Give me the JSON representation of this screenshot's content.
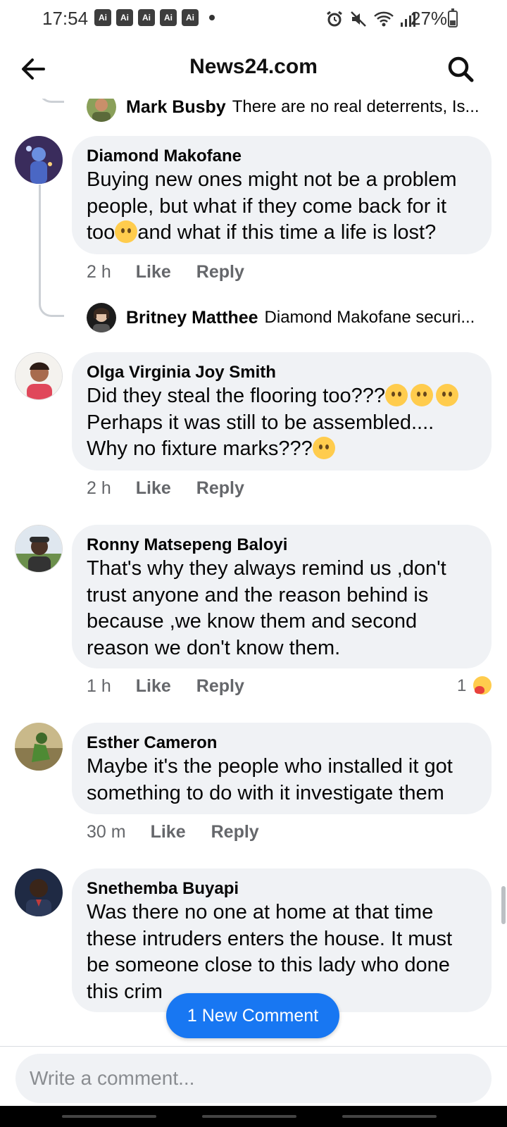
{
  "status_bar": {
    "time": "17:54",
    "ai_badges": [
      "Ai",
      "Ai",
      "Ai",
      "Ai",
      "Ai"
    ],
    "battery": "27%",
    "icons": [
      "alarm-icon",
      "mute-icon",
      "wifi-icon",
      "signal-icon",
      "battery-icon"
    ]
  },
  "header": {
    "title": "News24.com",
    "back_icon": "arrow-left-icon",
    "search_icon": "search-icon"
  },
  "comments": {
    "top_reply": {
      "author": "Mark Busby",
      "text": "There are no real deterrents, Is..."
    },
    "items": [
      {
        "author": "Diamond Makofane",
        "text_before_emoji": "Buying new ones might not be a problem people, but what if they come back for it too",
        "text_after_emoji": "and what if this time a life is lost?",
        "time": "2 h",
        "like": "Like",
        "reply": "Reply",
        "reply_preview": {
          "author": "Britney Matthee",
          "text": "Diamond Makofane securi..."
        }
      },
      {
        "author": "Olga Virginia Joy Smith",
        "line1": "Did they steal the flooring too???",
        "line2": "Perhaps it was still to be assembled....",
        "line3": "Why no fixture marks???",
        "time": "2 h",
        "like": "Like",
        "reply": "Reply"
      },
      {
        "author": "Ronny Matsepeng Baloyi",
        "text": "That's why they always remind us ,don't trust anyone and the reason behind is because ,we know them and second reason we don't know them.",
        "time": "1 h",
        "like": "Like",
        "reply": "Reply",
        "reaction_count": "1"
      },
      {
        "author": "Esther Cameron",
        "text": "Maybe it's the people who installed it got something to do with it investigate them",
        "time": "30 m",
        "like": "Like",
        "reply": "Reply"
      },
      {
        "author": "Snethemba Buyapi",
        "text": "Was there no one at home at that time these intruders enters the house. It must be someone close to this lady who done this crim"
      }
    ]
  },
  "new_comment_pill": "1 New Comment",
  "composer": {
    "placeholder": "Write a comment..."
  },
  "colors": {
    "bubble": "#f0f2f5",
    "accent": "#1877f2",
    "secondary_text": "#65676b"
  }
}
